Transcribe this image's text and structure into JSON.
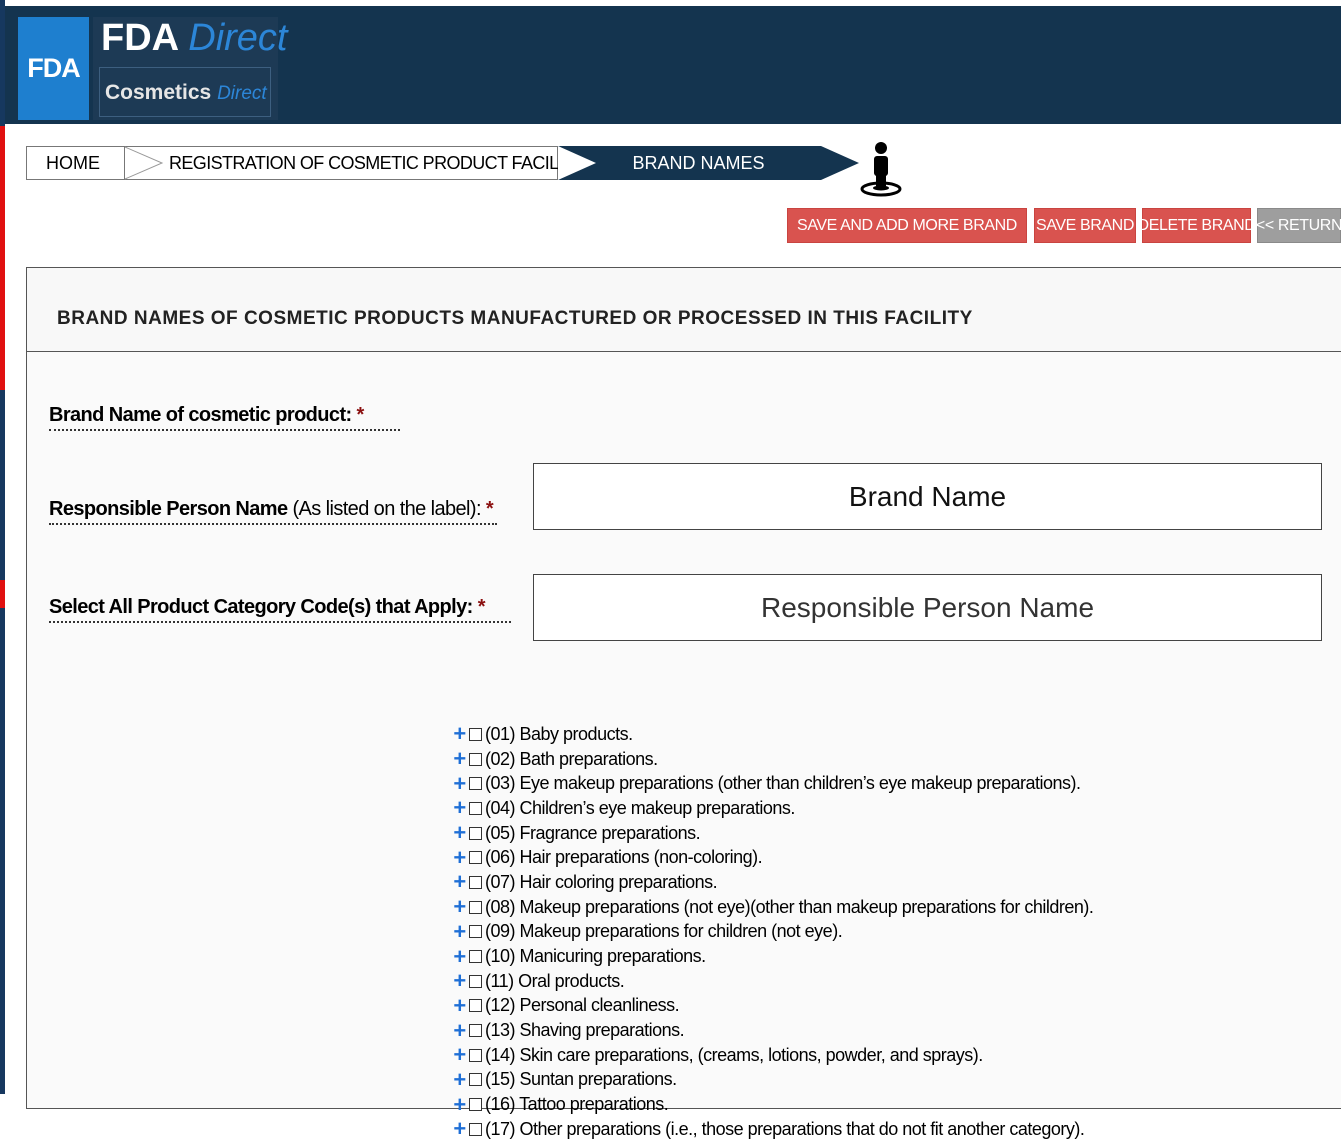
{
  "header": {
    "fda_logo": "FDA",
    "brand_main": "FDA",
    "brand_main_accent": "Direct",
    "brand_sub": "Cosmetics",
    "brand_sub_accent": "Direct"
  },
  "breadcrumb": {
    "home": "HOME",
    "registration": "REGISTRATION OF COSMETIC PRODUCT FACILITY",
    "current": "BRAND NAMES",
    "icon": "person-pin-icon"
  },
  "actions": {
    "save_add_more": "SAVE AND ADD MORE BRAND",
    "save": "SAVE BRAND",
    "delete": "DELETE BRAND",
    "return": "<< RETURN"
  },
  "panel": {
    "title": "BRAND NAMES OF COSMETIC PRODUCTS MANUFACTURED OR PROCESSED IN THIS FACILITY"
  },
  "form": {
    "brand_label": "Brand Name of cosmetic product:",
    "brand_placeholder": "Brand Name",
    "responsible_label": "Responsible Person Name",
    "responsible_label_note": "(As listed on the label):",
    "responsible_placeholder": "Responsible Person Name",
    "category_label": "Select All Product Category Code(s) that Apply:",
    "required_mark": "*"
  },
  "categories": [
    "(01) Baby products.",
    "(02) Bath preparations.",
    "(03) Eye makeup preparations (other than children’s eye makeup preparations).",
    "(04) Children’s eye makeup preparations.",
    "(05) Fragrance preparations.",
    "(06) Hair preparations (non-coloring).",
    "(07) Hair coloring preparations.",
    "(08) Makeup preparations (not eye)(other than makeup preparations for children).",
    "(09) Makeup preparations for children (not eye).",
    "(10) Manicuring preparations.",
    "(11) Oral products.",
    "(12) Personal cleanliness.",
    "(13) Shaving preparations.",
    "(14) Skin care preparations, (creams, lotions, powder, and sprays).",
    "(15) Suntan preparations.",
    "(16) Tattoo preparations.",
    "(17) Other preparations (i.e., those preparations that do not fit another category)."
  ],
  "colors": {
    "header_bg": "#14344f",
    "fda_blue": "#1e7fcf",
    "action_red": "#d9534f",
    "action_gray": "#9e9e9e",
    "plus_blue": "#1f6fd6"
  }
}
